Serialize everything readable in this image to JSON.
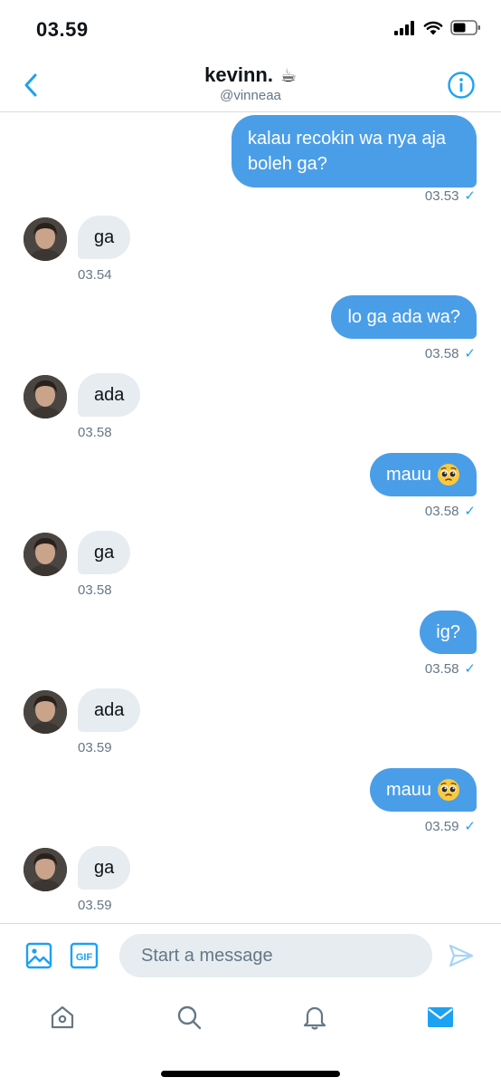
{
  "status_bar": {
    "time": "03.59"
  },
  "header": {
    "name": "kevinn.",
    "name_emoji": "☕",
    "handle": "@vinneaa"
  },
  "messages": [
    {
      "dir": "out",
      "text": "kalau recokin wa nya aja boleh ga?",
      "time": "03.53",
      "read": "✓"
    },
    {
      "dir": "in",
      "text": "ga",
      "time": "03.54"
    },
    {
      "dir": "out",
      "text": "lo ga ada wa?",
      "time": "03.58",
      "read": "✓"
    },
    {
      "dir": "in",
      "text": "ada",
      "time": "03.58"
    },
    {
      "dir": "out",
      "text": "mauu",
      "emoji": "pleading-face",
      "time": "03.58",
      "read": "✓"
    },
    {
      "dir": "in",
      "text": "ga",
      "time": "03.58"
    },
    {
      "dir": "out",
      "text": "ig?",
      "time": "03.58",
      "read": "✓"
    },
    {
      "dir": "in",
      "text": "ada",
      "time": "03.59"
    },
    {
      "dir": "out",
      "text": "mauu",
      "emoji": "pleading-face",
      "time": "03.59",
      "read": "✓"
    },
    {
      "dir": "in",
      "text": "ga",
      "time": "03.59"
    }
  ],
  "composer": {
    "placeholder": "Start a message",
    "gif_label": "GIF"
  },
  "colors": {
    "accent": "#1da1f2",
    "bubble_out": "#4a9ee8",
    "bubble_in": "#e6ecf0",
    "muted": "#657786"
  },
  "icons": [
    "back-chevron-icon",
    "info-icon",
    "image-icon",
    "gif-icon",
    "send-icon",
    "home-icon",
    "search-icon",
    "bell-icon",
    "mail-icon"
  ]
}
